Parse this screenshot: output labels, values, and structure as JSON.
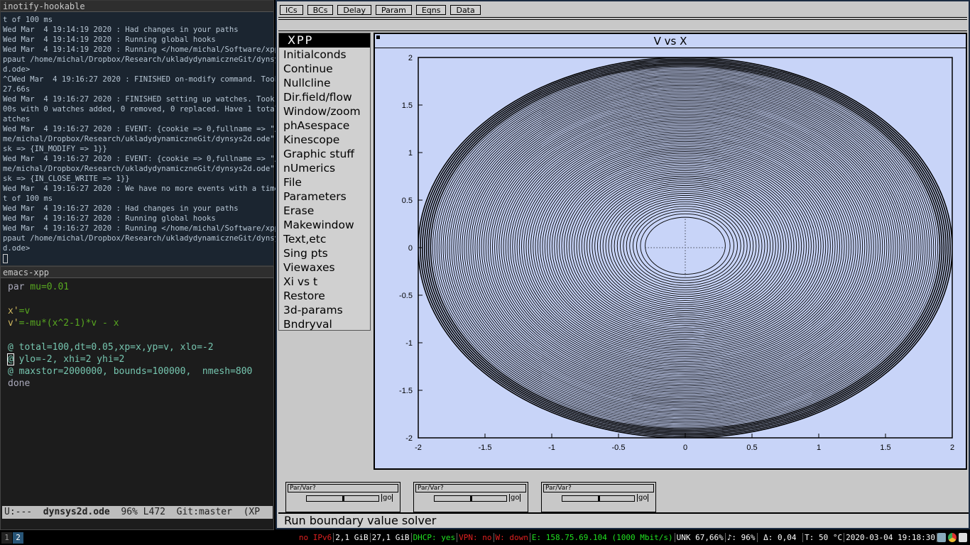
{
  "terminal": {
    "title": "inotify-hookable",
    "lines": [
      "t of 100 ms",
      "Wed Mar  4 19:14:19 2020 : Had changes in your paths",
      "Wed Mar  4 19:14:19 2020 : Running global hooks",
      "Wed Mar  4 19:14:19 2020 : Running </home/michal/Software/xpp/x",
      "ppaut /home/michal/Dropbox/Research/ukladydynamiczneGit/dynsys2",
      "d.ode>",
      "^CWed Mar  4 19:16:27 2020 : FINISHED on-modify command. Took 1",
      "27.66s",
      "Wed Mar  4 19:16:27 2020 : FINISHED setting up watches. Took 0.",
      "00s with 0 watches added, 0 removed, 0 replaced. Have 1 total w",
      "atches",
      "Wed Mar  4 19:16:27 2020 : EVENT: {cookie => 0,fullname => \"/ho",
      "me/michal/Dropbox/Research/ukladydynamiczneGit/dynsys2d.ode\",ma",
      "sk => {IN_MODIFY => 1}}",
      "Wed Mar  4 19:16:27 2020 : EVENT: {cookie => 0,fullname => \"/ho",
      "me/michal/Dropbox/Research/ukladydynamiczneGit/dynsys2d.ode\",ma",
      "sk => {IN_CLOSE_WRITE => 1}}",
      "Wed Mar  4 19:16:27 2020 : We have no more events with a timeou",
      "t of 100 ms",
      "Wed Mar  4 19:16:27 2020 : Had changes in your paths",
      "Wed Mar  4 19:16:27 2020 : Running global hooks",
      "Wed Mar  4 19:16:27 2020 : Running </home/michal/Software/xpp/x",
      "ppaut /home/michal/Dropbox/Research/ukladydynamiczneGit/dynsys2",
      "d.ode>"
    ]
  },
  "emacs": {
    "title": "emacs-xpp",
    "l1a": "par",
    "l1b": " mu=0.01",
    "l2a": "x'",
    "l2b": "=v",
    "l3a": "v'",
    "l3b": "=-mu*(x^2-1)*v - x",
    "l4": "@ total=100,dt=0.05,xp=x,yp=v, xlo=-2",
    "l5a": "@",
    "l5b": " ylo=-2, xhi=2 yhi=2",
    "l6": "@ maxstor=2000000, bounds=100000,  nmesh=800",
    "l7": "done",
    "mode": {
      "state": "U:---",
      "file": "dynsys2d.ode",
      "pos": "96% L472",
      "git": "Git:master",
      "mode": "(XP"
    }
  },
  "workspaces": [
    "1",
    "2"
  ],
  "statusbar": [
    {
      "text": "no IPv6",
      "color": "#e02020"
    },
    {
      "text": "2,1 GiB",
      "color": "#ffffff"
    },
    {
      "text": "27,1 GiB",
      "color": "#ffffff"
    },
    {
      "text": "DHCP: yes",
      "color": "#20e020"
    },
    {
      "text": "VPN: no",
      "color": "#e02020"
    },
    {
      "text": "W: down",
      "color": "#e02020"
    },
    {
      "text": "E: 158.75.69.104 (1000 Mbit/s)",
      "color": "#20e020"
    },
    {
      "text": "UNK 67,66%",
      "color": "#ffffff"
    },
    {
      "text": "♪: 96%",
      "color": "#ffffff"
    },
    {
      "text": " Δ: 0,04 ",
      "color": "#ffffff"
    },
    {
      "text": "T: 50 °C",
      "color": "#ffffff"
    },
    {
      "text": "2020-03-04 19:18:30",
      "color": "#ffffff"
    }
  ],
  "xpp": {
    "top_buttons": [
      "ICs",
      "BCs",
      "Delay",
      "Param",
      "Eqns",
      "Data"
    ],
    "menu_title": "XPP",
    "menu": [
      "Initialconds",
      "Continue",
      "Nullcline",
      "Dir.field/flow",
      "Window/zoom",
      "phAsespace",
      "Kinescope",
      "Graphic stuff",
      "nUmerics",
      "File",
      "Parameters",
      "Erase",
      "Makewindow",
      "Text,etc",
      "Sing pts",
      "Viewaxes",
      "Xi vs t",
      "Restore",
      "3d-params",
      "Bndryval"
    ],
    "sliders": [
      {
        "label": "Par/Var?",
        "go": "go",
        "value": 0.5
      },
      {
        "label": "Par/Var?",
        "go": "go",
        "value": 0.5
      },
      {
        "label": "Par/Var?",
        "go": "go",
        "value": 0.5
      }
    ],
    "info": "Run boundary value solver",
    "plot_bg": "#c8d4f8"
  },
  "chart_data": {
    "type": "line",
    "title": "V vs X",
    "xlim": [
      -2,
      2
    ],
    "ylim": [
      -2,
      2
    ],
    "xticks": [
      "-2",
      "-1.5",
      "-1",
      "-0.5",
      "0",
      "0.5",
      "1",
      "1.5",
      "2"
    ],
    "yticks": [
      "2",
      "1.5",
      "1",
      "0.5",
      "0",
      "-0.5",
      "-1",
      "-1.5",
      "-2"
    ],
    "trajectory": {
      "shape": "outward spiral",
      "r_inner": 0.3,
      "r_outer": 2.0
    },
    "grid": false
  }
}
